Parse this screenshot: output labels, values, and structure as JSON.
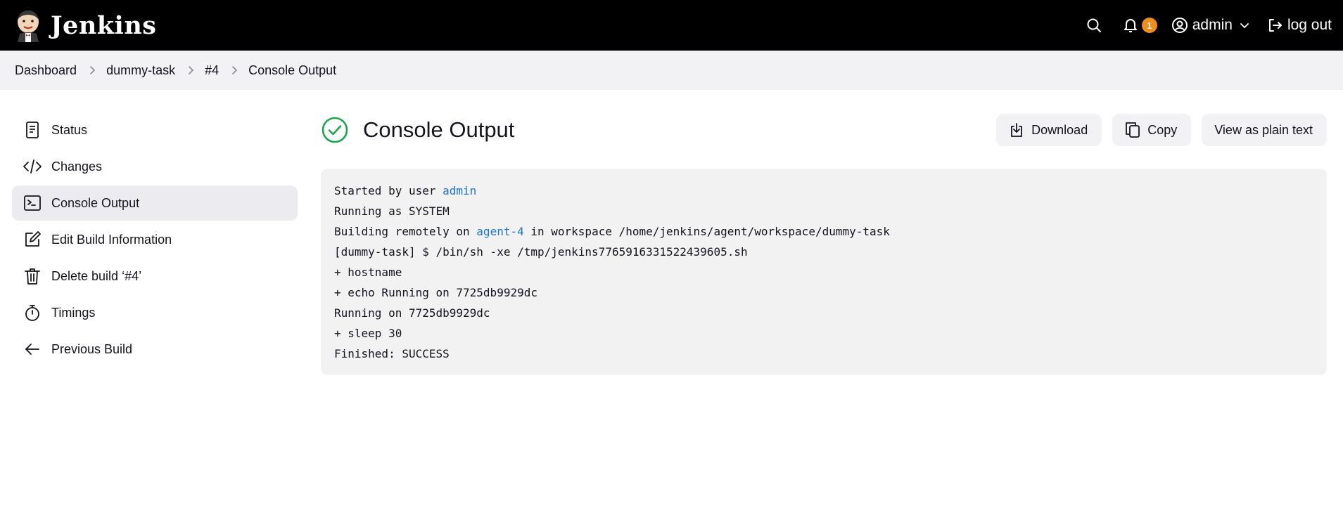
{
  "header": {
    "brand": "Jenkins",
    "notification_count": "1",
    "user": "admin",
    "logout": "log out"
  },
  "breadcrumb": [
    "Dashboard",
    "dummy-task",
    "#4",
    "Console Output"
  ],
  "sidebar": {
    "items": [
      {
        "label": "Status",
        "icon": "document-icon"
      },
      {
        "label": "Changes",
        "icon": "code-icon"
      },
      {
        "label": "Console Output",
        "icon": "terminal-icon",
        "active": true
      },
      {
        "label": "Edit Build Information",
        "icon": "edit-icon"
      },
      {
        "label": "Delete build ‘#4’",
        "icon": "trash-icon"
      },
      {
        "label": "Timings",
        "icon": "stopwatch-icon"
      },
      {
        "label": "Previous Build",
        "icon": "arrow-left-icon"
      }
    ]
  },
  "main": {
    "title": "Console Output",
    "status": "success",
    "actions": {
      "download": "Download",
      "copy": "Copy",
      "plain": "View as plain text"
    }
  },
  "console": {
    "line1": {
      "prefix": "Started by user ",
      "link": "admin"
    },
    "line2": "Running as SYSTEM",
    "line3": {
      "prefix": "Building remotely on ",
      "link": "agent-4",
      "suffix": " in workspace /home/jenkins/agent/workspace/dummy-task"
    },
    "line4": "[dummy-task] $ /bin/sh -xe /tmp/jenkins7765916331522439605.sh",
    "line5": "+ hostname",
    "line6": "+ echo Running on 7725db9929dc",
    "line7": "Running on 7725db9929dc",
    "line8": "+ sleep 30",
    "line9": "Finished: SUCCESS"
  },
  "colors": {
    "header_bg": "#000000",
    "badge": "#f28c1b",
    "success": "#1ea64a",
    "link": "#1a73d9",
    "breadcrumb_bg": "#f2f2f5",
    "console_bg": "#f2f2f2"
  }
}
